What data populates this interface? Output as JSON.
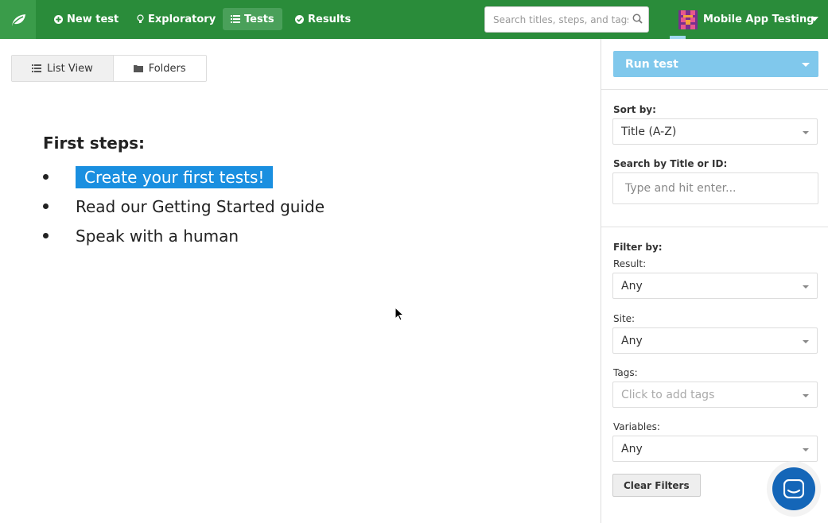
{
  "nav": {
    "items": [
      {
        "icon": "plus-circle-icon",
        "label": "New test"
      },
      {
        "icon": "lightbulb-icon",
        "label": "Exploratory"
      },
      {
        "icon": "list-icon",
        "label": "Tests"
      },
      {
        "icon": "check-circle-icon",
        "label": "Results"
      }
    ],
    "active": "Tests",
    "search_placeholder": "Search titles, steps, and tags",
    "project_name": "Mobile App Testing",
    "color": "#2a8c3a"
  },
  "view_toggle": {
    "list_label": "List View",
    "folders_label": "Folders"
  },
  "main": {
    "first_steps_title": "First steps:",
    "steps": [
      "Create your first tests!",
      "Read our Getting Started guide",
      "Speak with a human"
    ]
  },
  "sidebar": {
    "run_label": "Run test",
    "sort_label": "Sort by:",
    "sort_value": "Title (A-Z)",
    "search_label": "Search by Title or ID:",
    "search_placeholder": "Type and hit enter...",
    "filter_label": "Filter by:",
    "result_label": "Result:",
    "result_value": "Any",
    "site_label": "Site:",
    "site_value": "Any",
    "tags_label": "Tags:",
    "tags_placeholder": "Click to add tags",
    "variables_label": "Variables:",
    "variables_value": "Any",
    "clear_label": "Clear Filters"
  }
}
